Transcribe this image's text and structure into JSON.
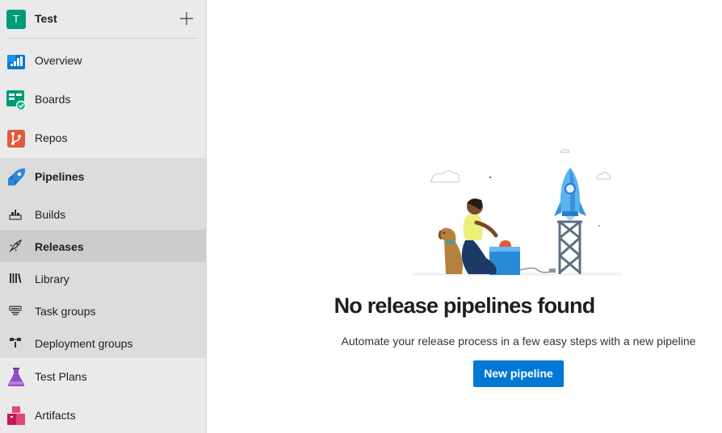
{
  "project": {
    "avatar_letter": "T",
    "name": "Test",
    "avatar_color": "#009b77"
  },
  "nav": {
    "overview": "Overview",
    "boards": "Boards",
    "repos": "Repos",
    "pipelines": "Pipelines",
    "pipelines_sub": {
      "builds": "Builds",
      "releases": "Releases",
      "library": "Library",
      "task_groups": "Task groups",
      "deployment_groups": "Deployment groups"
    },
    "test_plans": "Test Plans",
    "artifacts": "Artifacts"
  },
  "selected_item": "Releases",
  "empty_state": {
    "title": "No release pipelines found",
    "description": "Automate your release process in a few easy steps with a new pipeline",
    "button": "New pipeline"
  },
  "colors": {
    "accent": "#0078d4",
    "sidebar_bg": "#eaeaea",
    "group_bg": "#dcdcdc",
    "selected_bg": "#cccccc"
  }
}
